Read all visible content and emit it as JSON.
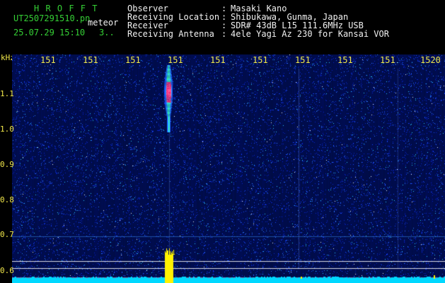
{
  "header": {
    "title": "H R O F F T",
    "filename": "UT2507291510.pn",
    "tag": "meteor",
    "datetime": "25.07.29 15:10",
    "interval": "3..",
    "info": [
      {
        "label": "Observer",
        "value": "Masaki Kano"
      },
      {
        "label": "Receiving Location",
        "value": "Shibukawa, Gunma, Japan"
      },
      {
        "label": "Receiver",
        "value": "SDR# 43dB L15 111.6MHz USB"
      },
      {
        "label": "Receiving Antenna",
        "value": "4ele Yagi Az 230 for Kansai VOR"
      }
    ]
  },
  "axis": {
    "unit": "kHz",
    "y_ticks": [
      "1.1",
      "1.0",
      "0.9",
      "0.8",
      "0.7",
      "0.6"
    ],
    "x_ticks": [
      "151",
      "151",
      "151",
      "151",
      "151",
      "151",
      "151",
      "151",
      "151",
      "1520"
    ]
  },
  "colors": {
    "header_green": "#35d035",
    "axis_yellow": "#f2e84a",
    "noise_base": "#000c6a",
    "baseline_cyan": "#00d8ff"
  }
}
